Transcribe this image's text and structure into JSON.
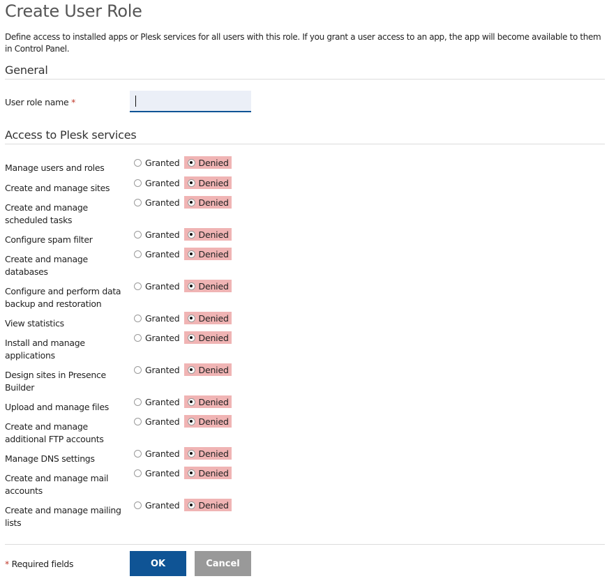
{
  "page": {
    "title": "Create User Role",
    "description": "Define access to installed apps or Plesk services for all users with this role. If you grant a user access to an app, the app will become available to them in Control Panel."
  },
  "general": {
    "heading": "General",
    "user_role_name": {
      "label": "User role name",
      "required_mark": "*",
      "value": "",
      "placeholder": ""
    }
  },
  "access": {
    "heading": "Access to Plesk services",
    "option_granted": "Granted",
    "option_denied": "Denied",
    "denied_highlight_color": "#f0b4b4",
    "permissions": [
      {
        "label": "Manage users and roles",
        "value": "Denied"
      },
      {
        "label": "Create and manage sites",
        "value": "Denied"
      },
      {
        "label": "Create and manage scheduled tasks",
        "value": "Denied"
      },
      {
        "label": "Configure spam filter",
        "value": "Denied"
      },
      {
        "label": "Create and manage databases",
        "value": "Denied"
      },
      {
        "label": "Configure and perform data backup and restoration",
        "value": "Denied"
      },
      {
        "label": "View statistics",
        "value": "Denied"
      },
      {
        "label": "Install and manage applications",
        "value": "Denied"
      },
      {
        "label": "Design sites in Presence Builder",
        "value": "Denied"
      },
      {
        "label": "Upload and manage files",
        "value": "Denied"
      },
      {
        "label": "Create and manage additional FTP accounts",
        "value": "Denied"
      },
      {
        "label": "Manage DNS settings",
        "value": "Denied"
      },
      {
        "label": "Create and manage mail accounts",
        "value": "Denied"
      },
      {
        "label": "Create and manage mailing lists",
        "value": "Denied"
      }
    ]
  },
  "footer": {
    "required_mark": "*",
    "required_note": "Required fields",
    "ok_label": "OK",
    "cancel_label": "Cancel",
    "ok_color": "#0f5495",
    "cancel_color": "#999999"
  }
}
